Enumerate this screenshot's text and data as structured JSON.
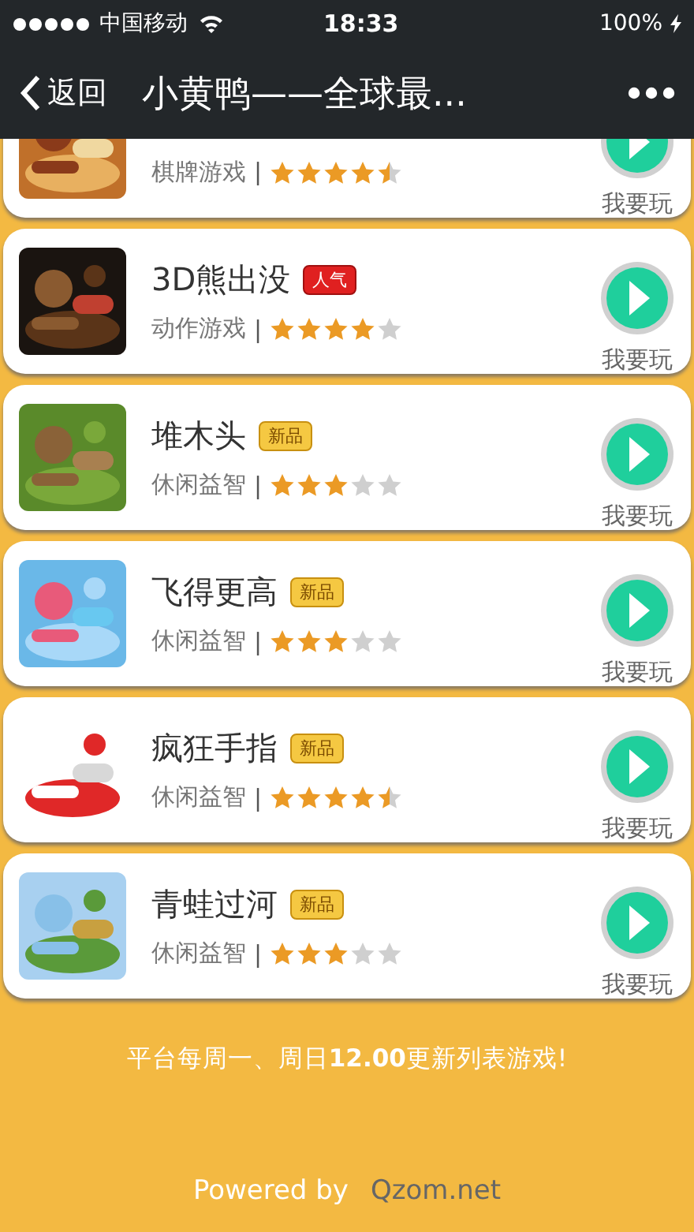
{
  "status_bar": {
    "carrier": "中国移动",
    "time": "18:33",
    "battery": "100%"
  },
  "nav_bar": {
    "back": "返回",
    "title": "小黄鸭——全球最..."
  },
  "games": [
    {
      "category": "棋牌游戏",
      "separator": "|",
      "stars": 4.5,
      "action": "我要玩"
    },
    {
      "name": "3D熊出没",
      "badge": {
        "kind": "hot",
        "label": "人气"
      },
      "category": "动作游戏",
      "separator": "|",
      "stars": 4,
      "action": "我要玩"
    },
    {
      "name": "堆木头",
      "badge": {
        "kind": "new",
        "label": "新品"
      },
      "category": "休闲益智",
      "separator": "|",
      "stars": 3,
      "action": "我要玩"
    },
    {
      "name": "飞得更高",
      "badge": {
        "kind": "new",
        "label": "新品"
      },
      "category": "休闲益智",
      "separator": "|",
      "stars": 3,
      "action": "我要玩"
    },
    {
      "name": "疯狂手指",
      "badge": {
        "kind": "new",
        "label": "新品"
      },
      "category": "休闲益智",
      "separator": "|",
      "stars": 4.5,
      "action": "我要玩"
    },
    {
      "name": "青蛙过河",
      "badge": {
        "kind": "new",
        "label": "新品"
      },
      "category": "休闲益智",
      "separator": "|",
      "stars": 3,
      "action": "我要玩"
    }
  ],
  "notice": "平台每周一、周日**12.00**更新列表游戏!",
  "footer": {
    "powered_by": "Powered by",
    "site": "Qzom.net"
  }
}
